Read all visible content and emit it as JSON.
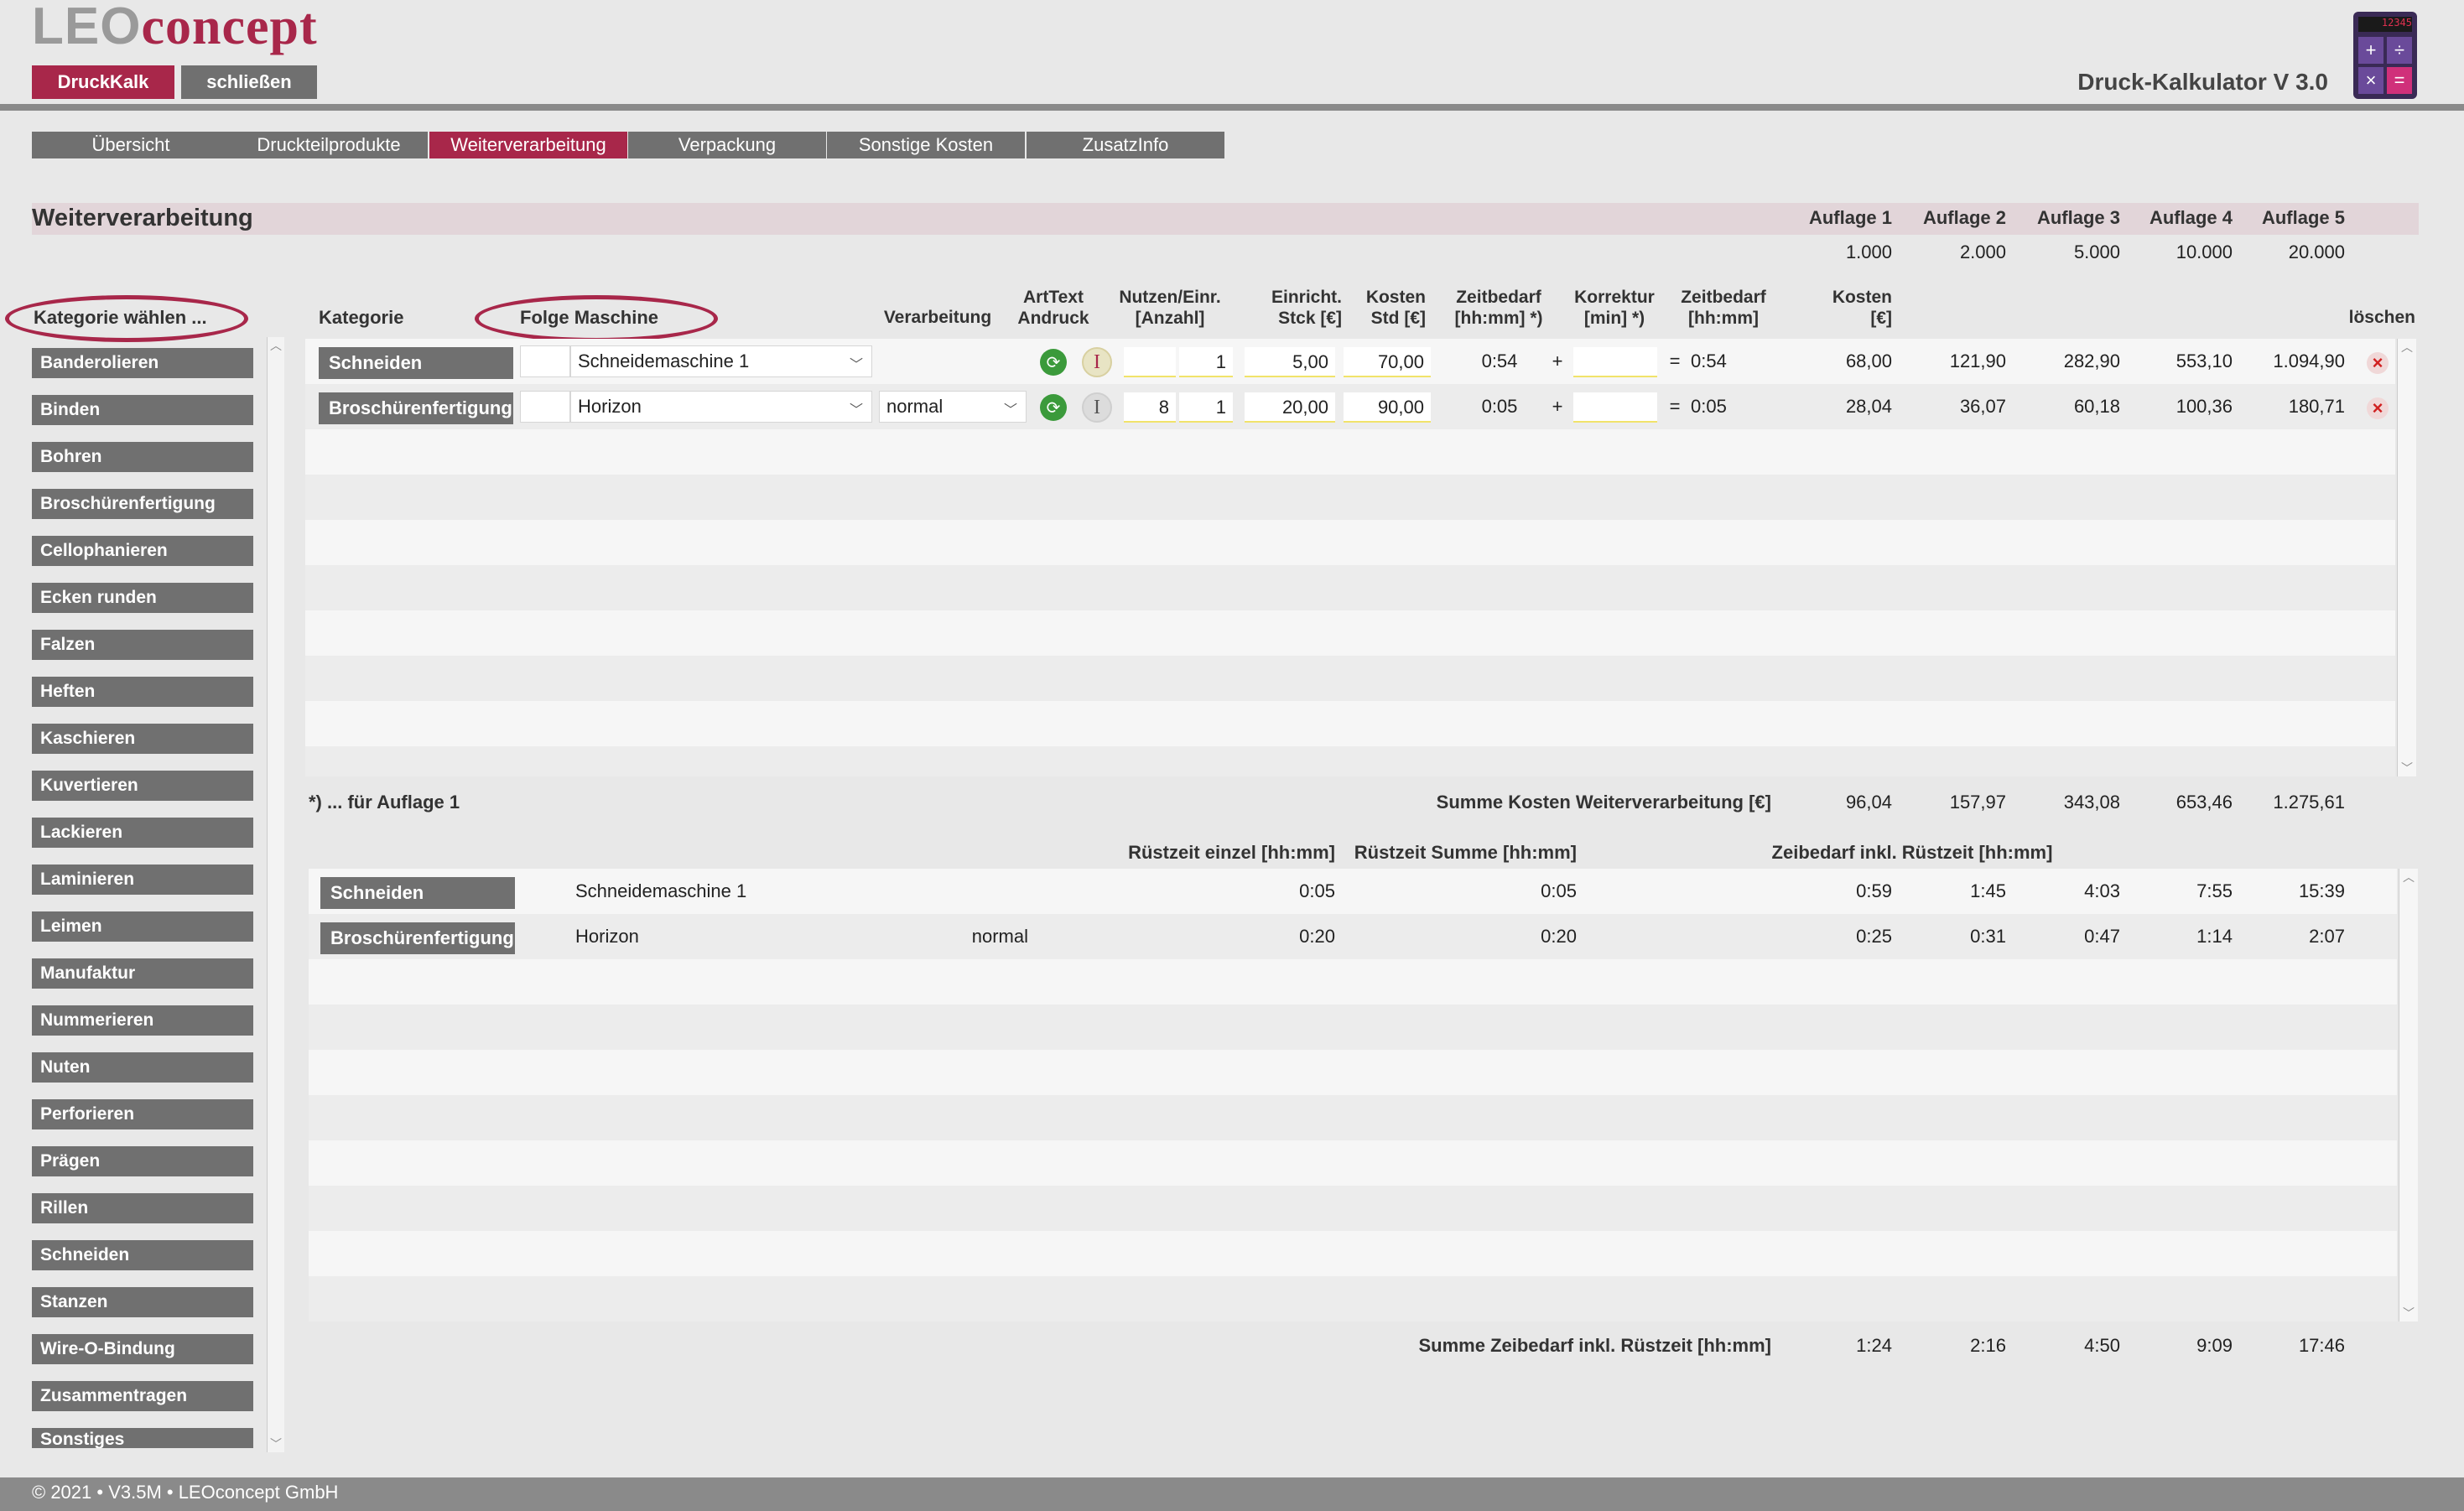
{
  "header": {
    "logo_part1": "LEO",
    "logo_part2": "concept",
    "btn_druckkalk": "DruckKalk",
    "btn_schliessen": "schließen",
    "app_title": "Druck-Kalkulator V 3.0",
    "calc_display": "12345"
  },
  "tabs": [
    "Übersicht",
    "Druckteilprodukte",
    "Weiterverarbeitung",
    "Verpackung",
    "Sonstige Kosten",
    "ZusatzInfo"
  ],
  "active_tab": "Weiterverarbeitung",
  "section": {
    "title": "Weiterverarbeitung",
    "auflagen": [
      "Auflage 1",
      "Auflage 2",
      "Auflage 3",
      "Auflage 4",
      "Auflage 5"
    ],
    "auflage_values": [
      "1.000",
      "2.000",
      "5.000",
      "10.000",
      "20.000"
    ]
  },
  "columns": {
    "kategorie_waehlen": "Kategorie wählen ...",
    "kategorie": "Kategorie",
    "folge_maschine": "Folge Maschine",
    "verarbeitung": "Verarbeitung",
    "arttext_1": "ArtText",
    "arttext_2": "Andruck",
    "nutzen_1": "Nutzen/Einr.",
    "nutzen_2": "[Anzahl]",
    "einricht_1": "Einricht.",
    "einricht_2": "Stck [€]",
    "kosten_std_1": "Kosten",
    "kosten_std_2": "Std [€]",
    "zeitbedarf_1": "Zeitbedarf",
    "zeitbedarf_2": "[hh:mm] *)",
    "korrektur_1": "Korrektur",
    "korrektur_2": "[min] *)",
    "zeitbedarf2_1": "Zeitbedarf",
    "zeitbedarf2_2": "[hh:mm]",
    "kosten_1": "Kosten",
    "kosten_2": "[€]",
    "loeschen": "löschen"
  },
  "categories": [
    "Banderolieren",
    "Binden",
    "Bohren",
    "Broschürenfertigung",
    "Cellophanieren",
    "Ecken runden",
    "Falzen",
    "Heften",
    "Kaschieren",
    "Kuvertieren",
    "Lackieren",
    "Laminieren",
    "Leimen",
    "Manufaktur",
    "Nummerieren",
    "Nuten",
    "Perforieren",
    "Prägen",
    "Rillen",
    "Schneiden",
    "Stanzen",
    "Wire-O-Bindung",
    "Zusammentragen",
    "Sonstiges"
  ],
  "rows": [
    {
      "kategorie": "Schneiden",
      "maschine": "Schneidemaschine 1",
      "verarbeitung": "",
      "nutzen_a": "",
      "nutzen_b": "1",
      "einricht": "5,00",
      "kosten_std": "70,00",
      "zeitbedarf": "0:54",
      "plus": "+",
      "korrektur": "",
      "eq": "=",
      "zeitbedarf2": "0:54",
      "kosten": [
        "68,00",
        "121,90",
        "282,90",
        "553,10",
        "1.094,90"
      ]
    },
    {
      "kategorie": "Broschürenfertigung",
      "maschine": "Horizon",
      "verarbeitung": "normal",
      "nutzen_a": "8",
      "nutzen_b": "1",
      "einricht": "20,00",
      "kosten_std": "90,00",
      "zeitbedarf": "0:05",
      "plus": "+",
      "korrektur": "",
      "eq": "=",
      "zeitbedarf2": "0:05",
      "kosten": [
        "28,04",
        "36,07",
        "60,18",
        "100,36",
        "180,71"
      ]
    }
  ],
  "footnote": "*) ... für Auflage 1",
  "summe_kosten_label": "Summe Kosten Weiterverarbeitung [€]",
  "summe_kosten": [
    "96,04",
    "157,97",
    "343,08",
    "653,46",
    "1.275,61"
  ],
  "table2": {
    "h_ruest_einzel": "Rüstzeit einzel [hh:mm]",
    "h_ruest_summe": "Rüstzeit Summe [hh:mm]",
    "h_zeitbedarf": "Zeibedarf inkl. Rüstzeit [hh:mm]",
    "rows": [
      {
        "kategorie": "Schneiden",
        "maschine": "Schneidemaschine 1",
        "verarbeitung": "",
        "einzel": "0:05",
        "summe": "0:05",
        "zeiten": [
          "0:59",
          "1:45",
          "4:03",
          "7:55",
          "15:39"
        ]
      },
      {
        "kategorie": "Broschürenfertigung",
        "maschine": "Horizon",
        "verarbeitung": "normal",
        "einzel": "0:20",
        "summe": "0:20",
        "zeiten": [
          "0:25",
          "0:31",
          "0:47",
          "1:14",
          "2:07"
        ]
      }
    ],
    "summe_label": "Summe Zeibedarf inkl. Rüstzeit [hh:mm]",
    "summe": [
      "1:24",
      "2:16",
      "4:50",
      "9:09",
      "17:46"
    ]
  },
  "footer": {
    "copyright": "© 2021 • V3.5M • LEOconcept GmbH"
  },
  "colors": {
    "accent": "#a8274a",
    "button_grey": "#707070",
    "header_line": "#8a8a8a"
  },
  "icons": [
    "calculator-icon",
    "refresh-icon",
    "text-cursor-icon",
    "delete-icon",
    "chevron-down-icon"
  ]
}
